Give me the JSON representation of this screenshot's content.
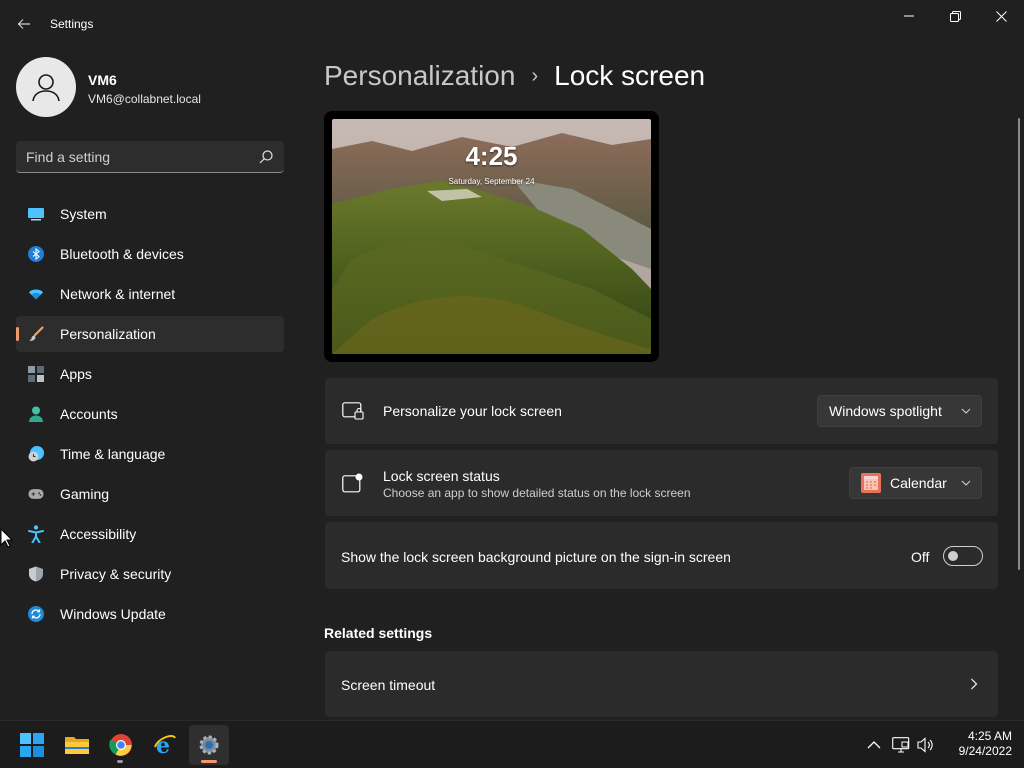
{
  "window": {
    "title": "Settings",
    "minimize_icon": "minimize-icon",
    "maximize_icon": "restore-icon",
    "close_icon": "close-icon"
  },
  "profile": {
    "name": "VM6",
    "email": "VM6@collabnet.local"
  },
  "search": {
    "placeholder": "Find a setting",
    "value": ""
  },
  "sidebar": {
    "items": [
      {
        "label": "System",
        "icon": "system-icon",
        "active": false
      },
      {
        "label": "Bluetooth & devices",
        "icon": "bluetooth-icon",
        "active": false
      },
      {
        "label": "Network & internet",
        "icon": "wifi-icon",
        "active": false
      },
      {
        "label": "Personalization",
        "icon": "brush-icon",
        "active": true
      },
      {
        "label": "Apps",
        "icon": "apps-icon",
        "active": false
      },
      {
        "label": "Accounts",
        "icon": "accounts-icon",
        "active": false
      },
      {
        "label": "Time & language",
        "icon": "clock-globe-icon",
        "active": false
      },
      {
        "label": "Gaming",
        "icon": "gamepad-icon",
        "active": false
      },
      {
        "label": "Accessibility",
        "icon": "accessibility-icon",
        "active": false
      },
      {
        "label": "Privacy & security",
        "icon": "shield-icon",
        "active": false
      },
      {
        "label": "Windows Update",
        "icon": "update-icon",
        "active": false
      }
    ]
  },
  "main": {
    "breadcrumb": {
      "parent": "Personalization",
      "separator": "›",
      "current": "Lock screen"
    },
    "preview": {
      "time": "4:25",
      "date": "Saturday, September 24"
    },
    "personalize": {
      "title": "Personalize your lock screen",
      "value": "Windows spotlight"
    },
    "status": {
      "title": "Lock screen status",
      "subtitle": "Choose an app to show detailed status on the lock screen",
      "value": "Calendar"
    },
    "signin_bg": {
      "title": "Show the lock screen background picture on the sign-in screen",
      "state_label": "Off",
      "on": false
    },
    "related": {
      "heading": "Related settings",
      "items": [
        {
          "label": "Screen timeout"
        }
      ]
    }
  },
  "taskbar": {
    "apps": [
      "start-icon",
      "file-explorer-icon",
      "chrome-icon",
      "internet-explorer-icon",
      "settings-icon"
    ],
    "tray": [
      "chevron-up-icon",
      "network-icon",
      "volume-icon"
    ],
    "time": "4:25 AM",
    "date": "9/24/2022"
  },
  "colors": {
    "background": "#202020",
    "card": "#2b2b2b",
    "accent": "#f2986f",
    "taskbar": "#1c1c1c"
  }
}
